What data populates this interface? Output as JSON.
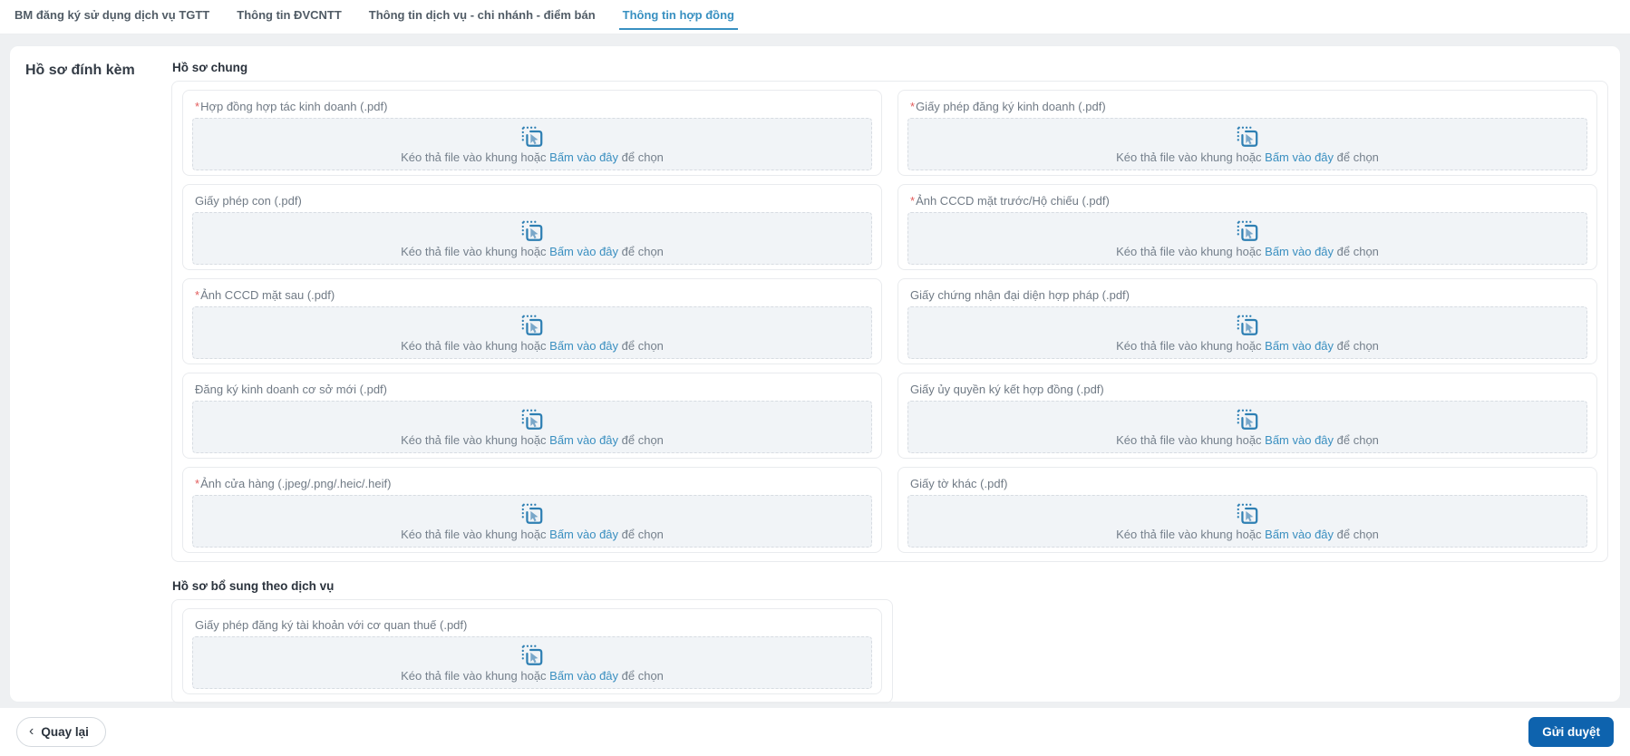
{
  "tabs": [
    {
      "label": "BM đăng ký sử dụng dịch vụ TGTT",
      "active": false
    },
    {
      "label": "Thông tin ĐVCNTT",
      "active": false
    },
    {
      "label": "Thông tin dịch vụ - chi nhánh - điểm bán",
      "active": false
    },
    {
      "label": "Thông tin hợp đồng",
      "active": true
    }
  ],
  "sidebar": {
    "title": "Hồ sơ đính kèm"
  },
  "sections": [
    {
      "title": "Hồ sơ chung",
      "fields": [
        {
          "label": "Hợp đồng hợp tác kinh doanh (.pdf)",
          "required": true
        },
        {
          "label": "Giấy phép đăng ký kinh doanh (.pdf)",
          "required": true
        },
        {
          "label": "Giấy phép con (.pdf)",
          "required": false
        },
        {
          "label": "Ảnh CCCD mặt trước/Hộ chiếu (.pdf)",
          "required": true
        },
        {
          "label": "Ảnh CCCD mặt sau (.pdf)",
          "required": true
        },
        {
          "label": "Giấy chứng nhận đại diện hợp pháp (.pdf)",
          "required": false
        },
        {
          "label": "Đăng ký kinh doanh cơ sở mới (.pdf)",
          "required": false
        },
        {
          "label": "Giấy ủy quyền ký kết hợp đồng (.pdf)",
          "required": false
        },
        {
          "label": "Ảnh cửa hàng (.jpeg/.png/.heic/.heif)",
          "required": true
        },
        {
          "label": "Giấy tờ khác (.pdf)",
          "required": false
        }
      ]
    },
    {
      "title": "Hồ sơ bổ sung theo dịch vụ",
      "fields": [
        {
          "label": "Giấy phép đăng ký tài khoản với cơ quan thuế (.pdf)",
          "required": false
        }
      ]
    }
  ],
  "dropzone": {
    "icon": "select-file-icon",
    "text_prefix": "Kéo thả file vào khung hoặc",
    "link_text": "Bấm vào đây",
    "text_suffix": "để chọn"
  },
  "footer": {
    "back_icon": "chevron-left-icon",
    "back_label": "Quay lại",
    "submit_label": "Gửi duyệt"
  },
  "colors": {
    "accent_blue": "#3890c1",
    "icon_blue": "#2e7fb3",
    "submit_blue": "#0e63ae",
    "required_red": "#e25c5c"
  }
}
